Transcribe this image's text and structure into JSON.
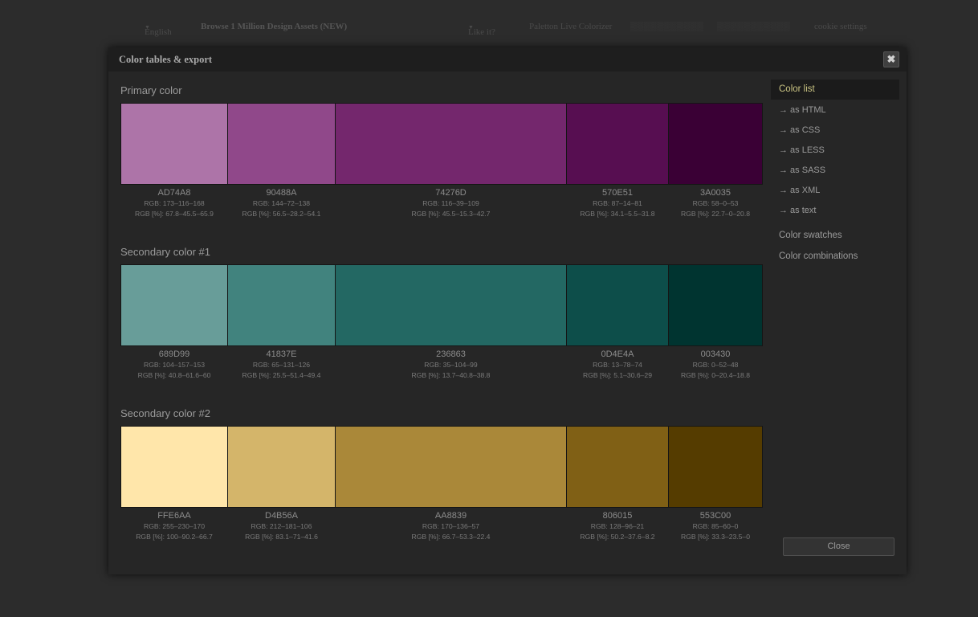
{
  "background": {
    "language": "English",
    "language_arrow": "▼",
    "browse_link": "Browse 1 Million Design Assets (NEW)",
    "like_it": "Like it?",
    "like_arrow": "▼",
    "paletton_link": "Paletton Live Colorizer",
    "cookie_settings": "cookie settings"
  },
  "modal": {
    "title": "Color tables & export",
    "close_x": "✖",
    "close_button": "Close"
  },
  "sidebar": {
    "color_list": "Color list",
    "as_html": "→ as HTML",
    "as_css": "→ as CSS",
    "as_less": "→ as LESS",
    "as_sass": "→ as SASS",
    "as_xml": "→ as XML",
    "as_text": "→ as text",
    "color_swatches": "Color swatches",
    "color_combinations": "Color combinations"
  },
  "sections": [
    {
      "title": "Primary color",
      "swatches": [
        {
          "hex": "AD74A8",
          "color": "#AD74A8",
          "rgb": "RGB: 173–116–168",
          "pct": "RGB [%]: 67.8–45.5–65.9"
        },
        {
          "hex": "90488A",
          "color": "#90488A",
          "rgb": "RGB: 144–72–138",
          "pct": "RGB [%]: 56.5–28.2–54.1"
        },
        {
          "hex": "74276D",
          "color": "#74276D",
          "rgb": "RGB: 116–39–109",
          "pct": "RGB [%]: 45.5–15.3–42.7"
        },
        {
          "hex": "570E51",
          "color": "#570E51",
          "rgb": "RGB: 87–14–81",
          "pct": "RGB [%]: 34.1–5.5–31.8"
        },
        {
          "hex": "3A0035",
          "color": "#3A0035",
          "rgb": "RGB: 58–0–53",
          "pct": "RGB [%]: 22.7–0–20.8"
        }
      ]
    },
    {
      "title": "Secondary color #1",
      "swatches": [
        {
          "hex": "689D99",
          "color": "#689D99",
          "rgb": "RGB: 104–157–153",
          "pct": "RGB [%]: 40.8–61.6–60"
        },
        {
          "hex": "41837E",
          "color": "#41837E",
          "rgb": "RGB: 65–131–126",
          "pct": "RGB [%]: 25.5–51.4–49.4"
        },
        {
          "hex": "236863",
          "color": "#236863",
          "rgb": "RGB: 35–104–99",
          "pct": "RGB [%]: 13.7–40.8–38.8"
        },
        {
          "hex": "0D4E4A",
          "color": "#0D4E4A",
          "rgb": "RGB: 13–78–74",
          "pct": "RGB [%]: 5.1–30.6–29"
        },
        {
          "hex": "003430",
          "color": "#003430",
          "rgb": "RGB: 0–52–48",
          "pct": "RGB [%]: 0–20.4–18.8"
        }
      ]
    },
    {
      "title": "Secondary color #2",
      "swatches": [
        {
          "hex": "FFE6AA",
          "color": "#FFE6AA",
          "rgb": "RGB: 255–230–170",
          "pct": "RGB [%]: 100–90.2–66.7"
        },
        {
          "hex": "D4B56A",
          "color": "#D4B56A",
          "rgb": "RGB: 212–181–106",
          "pct": "RGB [%]: 83.1–71–41.6"
        },
        {
          "hex": "AA8839",
          "color": "#AA8839",
          "rgb": "RGB: 170–136–57",
          "pct": "RGB [%]: 66.7–53.3–22.4"
        },
        {
          "hex": "806015",
          "color": "#806015",
          "rgb": "RGB: 128–96–21",
          "pct": "RGB [%]: 50.2–37.6–8.2"
        },
        {
          "hex": "553C00",
          "color": "#553C00",
          "rgb": "RGB: 85–60–0",
          "pct": "RGB [%]: 33.3–23.5–0"
        }
      ]
    }
  ]
}
